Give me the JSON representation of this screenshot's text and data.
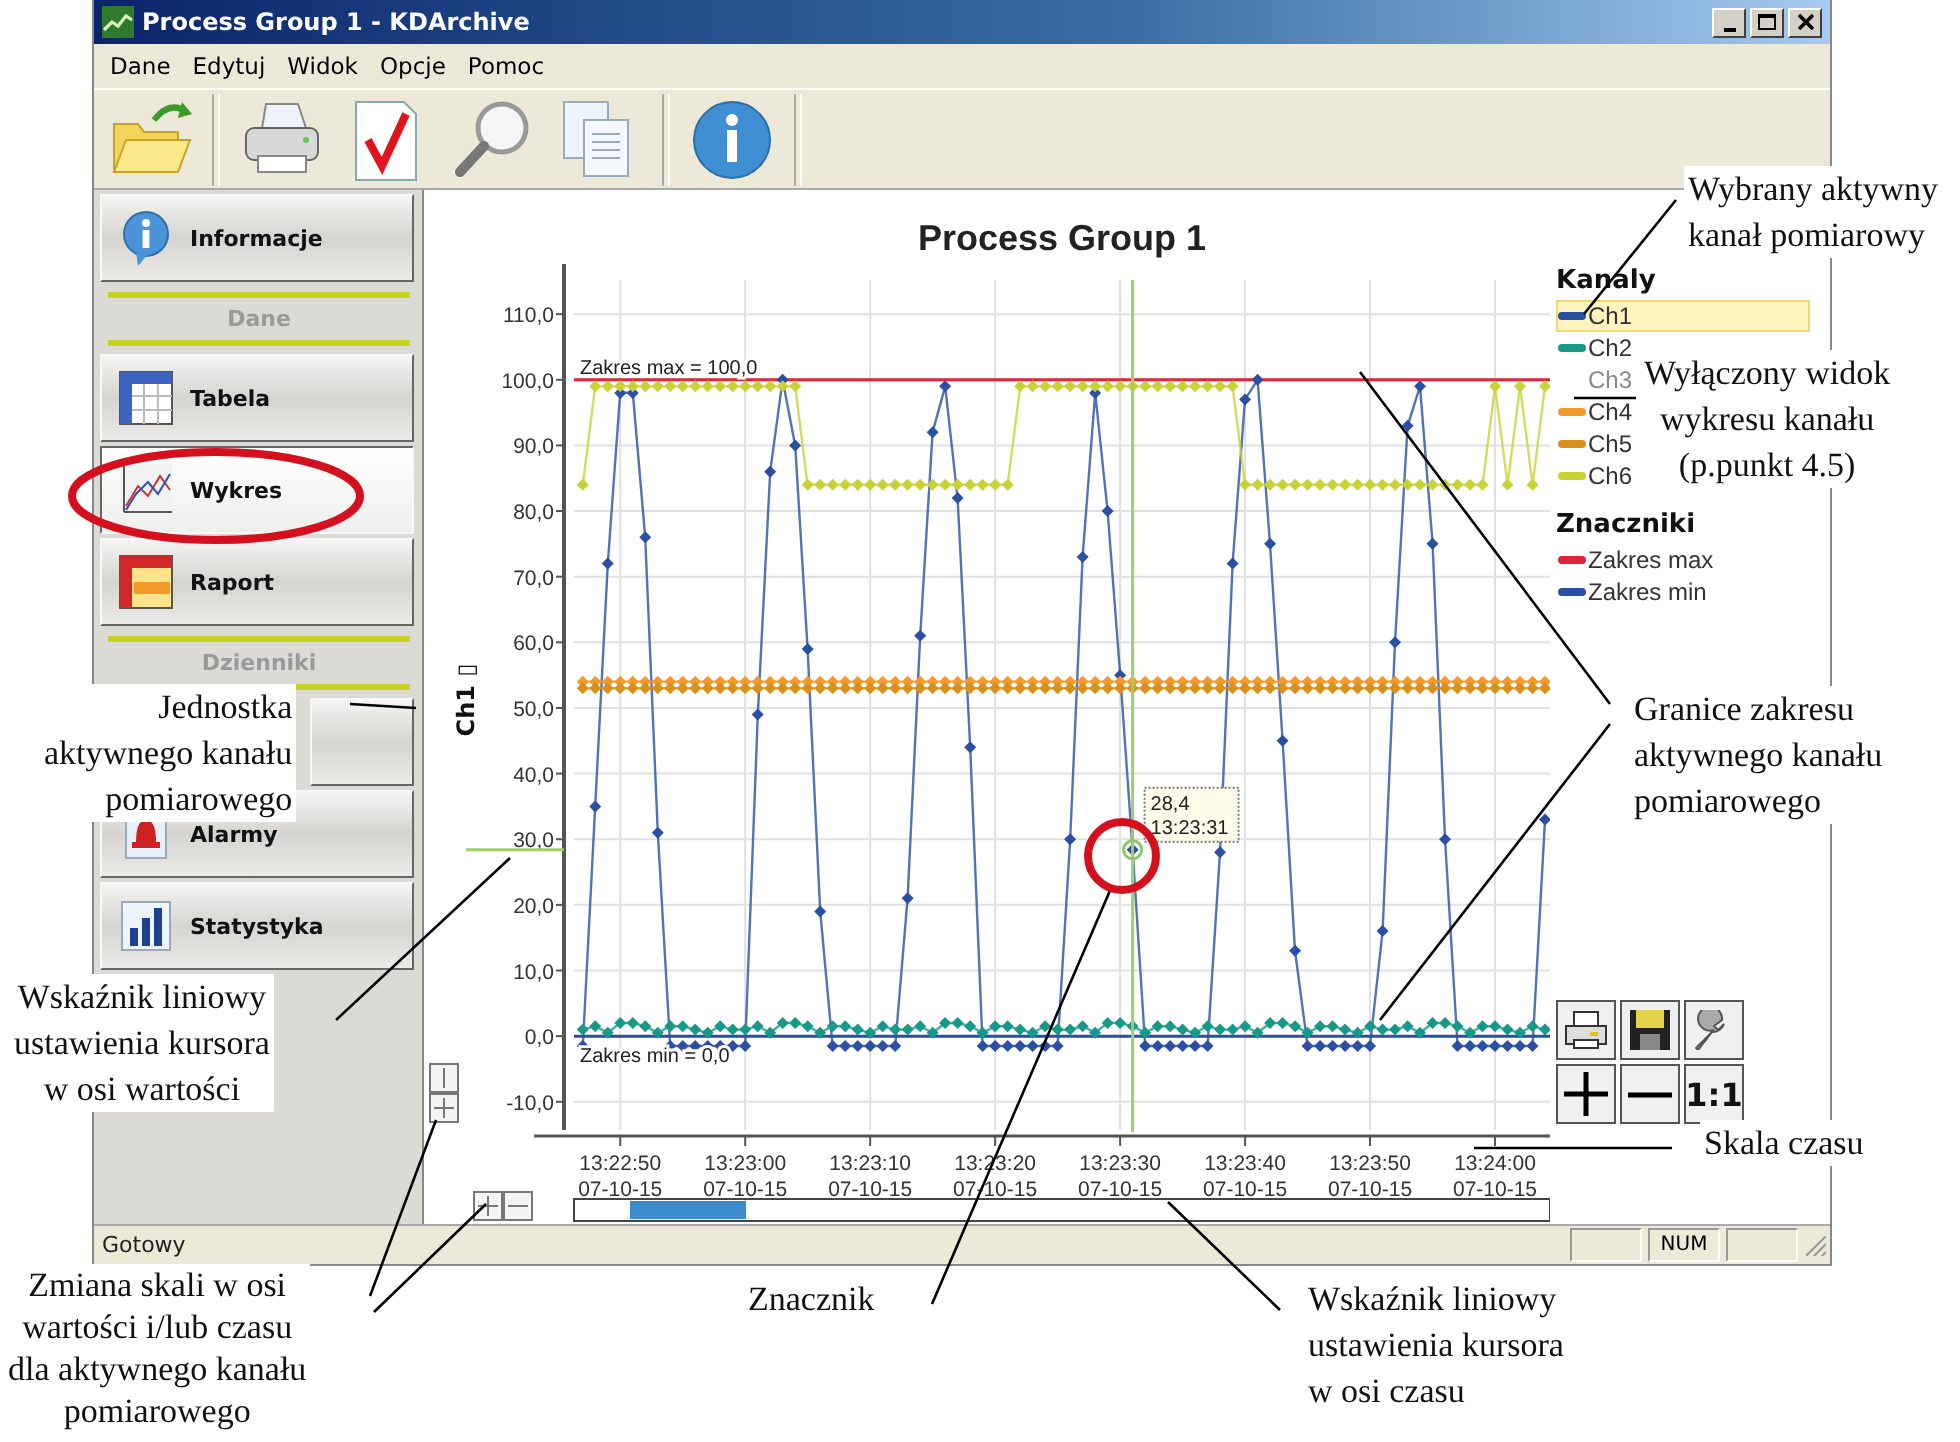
{
  "window": {
    "title": "Process Group 1 - KDArchive"
  },
  "menu": [
    "Dane",
    "Edytuj",
    "Widok",
    "Opcje",
    "Pomoc"
  ],
  "sidebar": {
    "items": [
      {
        "kind": "button",
        "label": "Informacje",
        "selected": false
      },
      {
        "kind": "separator",
        "label": "Dane"
      },
      {
        "kind": "button",
        "label": "Tabela",
        "selected": false
      },
      {
        "kind": "button",
        "label": "Wykres",
        "selected": true
      },
      {
        "kind": "button",
        "label": "Raport",
        "selected": false
      },
      {
        "kind": "separator",
        "label": "Dzienniki"
      },
      {
        "kind": "button",
        "selected": false
      },
      {
        "kind": "button",
        "label": "Alarmy",
        "selected": false
      },
      {
        "kind": "button",
        "label": "Statystyka",
        "selected": false
      }
    ]
  },
  "chart": {
    "title": "Process Group 1",
    "legend": {
      "channels_title": "Kanaly",
      "channels": [
        {
          "name": "Ch1",
          "selected": true,
          "visible": true
        },
        {
          "name": "Ch2",
          "selected": false,
          "visible": true
        },
        {
          "name": "Ch3",
          "selected": false,
          "visible": false
        },
        {
          "name": "Ch4",
          "selected": false,
          "visible": true
        },
        {
          "name": "Ch5",
          "selected": false,
          "visible": true
        },
        {
          "name": "Ch6",
          "selected": false,
          "visible": true
        }
      ],
      "markers_title": "Znaczniki",
      "markers": [
        {
          "name": "Zakres max"
        },
        {
          "name": "Zakres min"
        }
      ]
    },
    "reset_button": "1:1",
    "chart_data": {
      "type": "line",
      "ylabel": "Ch1 ▯",
      "ylim": [
        -14.3,
        115.2
      ],
      "grid": true,
      "ref_lines": [
        {
          "axis": "y",
          "value": 100,
          "label": "Zakres max = 100,0",
          "color": "#e2233a"
        },
        {
          "axis": "y",
          "value": 0,
          "label": "Zakres min = 0,0",
          "color": "#2b4fa3"
        }
      ],
      "annotations": [
        "28,4",
        "13:23:31"
      ],
      "categories": [
        null,
        null,
        null,
        "13:22:50 07-10-15",
        null,
        null,
        null,
        null,
        null,
        null,
        null,
        null,
        null,
        "13:23:00 07-10-15",
        null,
        null,
        null,
        null,
        null,
        null,
        null,
        null,
        null,
        "13:23:10 07-10-15",
        null,
        null,
        null,
        null,
        null,
        null,
        null,
        null,
        null,
        "13:23:20 07-10-15",
        null,
        null,
        null,
        null,
        null,
        null,
        null,
        null,
        null,
        "13:23:30 07-10-15",
        null,
        null,
        null,
        null,
        null,
        null,
        null,
        null,
        null,
        "13:23:40 07-10-15",
        null,
        null,
        null,
        null,
        null,
        null,
        null,
        null,
        null,
        "13:23:50 07-10-15",
        null,
        null,
        null,
        null,
        null,
        null,
        null,
        null,
        null,
        "13:24:00 07-10-15",
        null,
        null,
        null,
        null
      ],
      "yticks": [
        {
          "value": -10,
          "label": "-10,0"
        },
        {
          "value": 0,
          "label": "0,0"
        },
        {
          "value": 10,
          "label": "10,0"
        },
        {
          "value": 20,
          "label": "20,0"
        },
        {
          "value": 30,
          "label": "30,0"
        },
        {
          "value": 40,
          "label": "40,0"
        },
        {
          "value": 50,
          "label": "50,0"
        },
        {
          "value": 60,
          "label": "60,0"
        },
        {
          "value": 70,
          "label": "70,0"
        },
        {
          "value": 80,
          "label": "80,0"
        },
        {
          "value": 90,
          "label": "90,0"
        },
        {
          "value": 100,
          "label": "100,0"
        },
        {
          "value": 110,
          "label": "110,0"
        }
      ],
      "series": [
        {
          "color": "#2b4fa3",
          "marker": "diamond",
          "values": [
            -1.5,
            35,
            72,
            98,
            98,
            76,
            31,
            -1.5,
            -1.5,
            -1.5,
            -1.5,
            -1.5,
            -1.5,
            -1.5,
            49,
            86,
            100,
            90,
            59,
            19,
            -1.5,
            -1.5,
            -1.5,
            -1.5,
            -1.5,
            -1.5,
            21,
            61,
            92,
            99,
            82,
            44,
            -1.5,
            -1.5,
            -1.5,
            -1.5,
            -1.5,
            -1.5,
            -1.5,
            30,
            73,
            98,
            80,
            55,
            28.4,
            -1.5,
            -1.5,
            -1.5,
            -1.5,
            -1.5,
            -1.5,
            28,
            72,
            97,
            100,
            75,
            45,
            13,
            -1.5,
            -1.5,
            -1.5,
            -1.5,
            -1.5,
            -1.5,
            16,
            60,
            93,
            99,
            75,
            30,
            -1.5,
            -1.5,
            -1.5,
            -1.5,
            -1.5,
            -1.5,
            -1.5,
            33
          ]
        },
        {
          "color": "#17998a",
          "marker": "diamond",
          "values": [
            1,
            1.5,
            0.5,
            2,
            2,
            1.5,
            0.5,
            1.5,
            1.5,
            1,
            0.5,
            1.5,
            1,
            1,
            1.5,
            0.5,
            2,
            2,
            1.5,
            0.5,
            1.5,
            1.5,
            1,
            0.5,
            1.5,
            1,
            1,
            1.5,
            0.5,
            2,
            2,
            1.5,
            0.5,
            1.5,
            1.5,
            1,
            0.5,
            1.5,
            1,
            1,
            1.5,
            0.5,
            2,
            2,
            1.5,
            0.5,
            1.5,
            1.5,
            1,
            0.5,
            1.5,
            1,
            1,
            1.5,
            0.5,
            2,
            2,
            1.5,
            0.5,
            1.5,
            1.5,
            1,
            0.5,
            1.5,
            1,
            1,
            1.5,
            0.5,
            2,
            2,
            1.5,
            0.5,
            1.5,
            1.5,
            1,
            0.5,
            1.5,
            1
          ]
        },
        {
          "color": "#f39a2c",
          "marker": "diamond",
          "values": [
            54,
            54,
            54,
            54,
            54,
            54,
            54,
            54,
            54,
            54,
            54,
            54,
            54,
            54,
            54,
            54,
            54,
            54,
            54,
            54,
            54,
            54,
            54,
            54,
            54,
            54,
            54,
            54,
            54,
            54,
            54,
            54,
            54,
            54,
            54,
            54,
            54,
            54,
            54,
            54,
            54,
            54,
            54,
            54,
            54,
            54,
            54,
            54,
            54,
            54,
            54,
            54,
            54,
            54,
            54,
            54,
            54,
            54,
            54,
            54,
            54,
            54,
            54,
            54,
            54,
            54,
            54,
            54,
            54,
            54,
            54,
            54,
            54,
            54,
            54,
            54,
            54,
            54
          ]
        },
        {
          "color": "#d9901a",
          "marker": "diamond",
          "values": [
            53,
            53,
            53,
            53,
            53,
            53,
            53,
            53,
            53,
            53,
            53,
            53,
            53,
            53,
            53,
            53,
            53,
            53,
            53,
            53,
            53,
            53,
            53,
            53,
            53,
            53,
            53,
            53,
            53,
            53,
            53,
            53,
            53,
            53,
            53,
            53,
            53,
            53,
            53,
            53,
            53,
            53,
            53,
            53,
            53,
            53,
            53,
            53,
            53,
            53,
            53,
            53,
            53,
            53,
            53,
            53,
            53,
            53,
            53,
            53,
            53,
            53,
            53,
            53,
            53,
            53,
            53,
            53,
            53,
            53,
            53,
            53,
            53,
            53,
            53,
            53,
            53,
            53
          ]
        },
        {
          "color": "#c9d234",
          "marker": "diamond",
          "values": [
            84,
            99,
            99,
            99,
            99,
            99,
            99,
            99,
            99,
            99,
            99,
            99,
            99,
            99,
            99,
            99,
            99,
            99,
            84,
            84,
            84,
            84,
            84,
            84,
            84,
            84,
            84,
            84,
            84,
            84,
            84,
            84,
            84,
            84,
            84,
            99,
            99,
            99,
            99,
            99,
            99,
            99,
            99,
            99,
            99,
            99,
            99,
            99,
            99,
            99,
            99,
            99,
            99,
            84,
            84,
            84,
            84,
            84,
            84,
            84,
            84,
            84,
            84,
            84,
            84,
            84,
            84,
            84,
            84,
            84,
            84,
            84,
            84,
            99,
            84,
            99,
            84,
            99
          ]
        }
      ]
    }
  },
  "status_bar": {
    "text": "Gotowy",
    "indicator": "NUM"
  },
  "callouts": [
    {
      "text": "Wybrany aktywny\nkanał  pomiarowy"
    },
    {
      "text": "Wyłączony widok\nwykresu kanału\n(p.punkt 4.5)"
    },
    {
      "text": "Jednostka\naktywnego kanału\npomiarowego"
    },
    {
      "text": "Granice zakresu\naktywnego kanału\npomiarowego"
    },
    {
      "text": "Wskaźnik liniowy\nustawienia kursora\nw osi wartości"
    },
    {
      "text": "Skala czasu"
    },
    {
      "text": "Zmiana skali  w osi\nwartości i/lub czasu\ndla aktywnego kanału\npomiarowego"
    },
    {
      "text": "Znacznik"
    },
    {
      "text": "Wskaźnik liniowy\nustawienia kursora\nw osi czasu"
    }
  ]
}
